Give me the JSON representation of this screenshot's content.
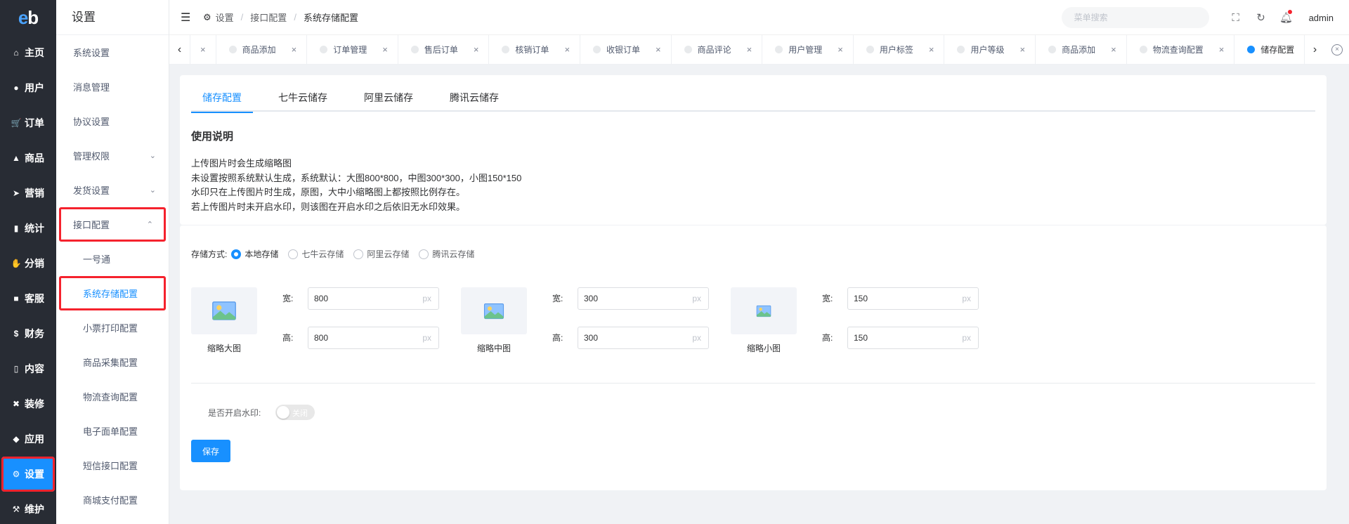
{
  "logo": {
    "text_e": "e",
    "text_b": "b"
  },
  "rail": [
    {
      "label": "主页",
      "icon": "home-icon",
      "glyph": "⌂"
    },
    {
      "label": "用户",
      "icon": "user-icon",
      "glyph": "●"
    },
    {
      "label": "订单",
      "icon": "cart-icon",
      "glyph": "🛒"
    },
    {
      "label": "商品",
      "icon": "basket-icon",
      "glyph": "▲"
    },
    {
      "label": "营销",
      "icon": "send-icon",
      "glyph": "➤"
    },
    {
      "label": "统计",
      "icon": "bar-chart-icon",
      "glyph": "▮"
    },
    {
      "label": "分销",
      "icon": "handshake-icon",
      "glyph": "✋"
    },
    {
      "label": "客服",
      "icon": "chat-icon",
      "glyph": "■"
    },
    {
      "label": "财务",
      "icon": "dollar-icon",
      "glyph": "$"
    },
    {
      "label": "内容",
      "icon": "book-icon",
      "glyph": "▯"
    },
    {
      "label": "装修",
      "icon": "tools-icon",
      "glyph": "✖"
    },
    {
      "label": "应用",
      "icon": "cube-icon",
      "glyph": "◆"
    },
    {
      "label": "设置",
      "icon": "gear-icon",
      "glyph": "⚙"
    },
    {
      "label": "维护",
      "icon": "hammer-icon",
      "glyph": "⚒"
    }
  ],
  "submenu": {
    "title": "设置",
    "items": [
      {
        "label": "系统设置"
      },
      {
        "label": "消息管理"
      },
      {
        "label": "协议设置"
      },
      {
        "label": "管理权限",
        "chev": "⌄"
      },
      {
        "label": "发货设置",
        "chev": "⌄"
      },
      {
        "label": "接口配置",
        "chev": "⌃"
      },
      {
        "label": "一号通"
      },
      {
        "label": "系统存储配置"
      },
      {
        "label": "小票打印配置"
      },
      {
        "label": "商品采集配置"
      },
      {
        "label": "物流查询配置"
      },
      {
        "label": "电子面单配置"
      },
      {
        "label": "短信接口配置"
      },
      {
        "label": "商城支付配置"
      }
    ]
  },
  "header": {
    "crumbs": [
      "设置",
      "接口配置",
      "系统存储配置"
    ],
    "search_placeholder": "菜单搜索",
    "username": "admin"
  },
  "tags": [
    "商品添加",
    "订单管理",
    "售后订单",
    "核销订单",
    "收银订单",
    "商品评论",
    "用户管理",
    "用户标签",
    "用户等级",
    "商品添加",
    "物流查询配置",
    "储存配置"
  ],
  "tabs": [
    "储存配置",
    "七牛云储存",
    "阿里云储存",
    "腾讯云储存"
  ],
  "instructions": {
    "title": "使用说明",
    "lines": [
      "上传图片时会生成缩略图",
      "未设置按照系统默认生成，系统默认：大图800*800，中图300*300，小图150*150",
      "水印只在上传图片时生成，原图，大中小缩略图上都按照比例存在。",
      "若上传图片时未开启水印，则该图在开启水印之后依旧无水印效果。"
    ]
  },
  "storage": {
    "label": "存储方式:",
    "options": [
      "本地存储",
      "七牛云存储",
      "阿里云存储",
      "腾讯云存储"
    ],
    "selected": "本地存储"
  },
  "thumbnails": [
    {
      "caption": "缩略大图",
      "width": "800",
      "height": "800"
    },
    {
      "caption": "缩略中图",
      "width": "300",
      "height": "300"
    },
    {
      "caption": "缩略小图",
      "width": "150",
      "height": "150"
    }
  ],
  "field_labels": {
    "width": "宽:",
    "height": "高:",
    "unit": "px"
  },
  "watermark": {
    "label": "是否开启水印:",
    "state": "关闭"
  },
  "save_label": "保存",
  "colors": {
    "primary": "#1890ff",
    "rail_bg": "#282c34",
    "highlight_border": "#f5222d"
  }
}
